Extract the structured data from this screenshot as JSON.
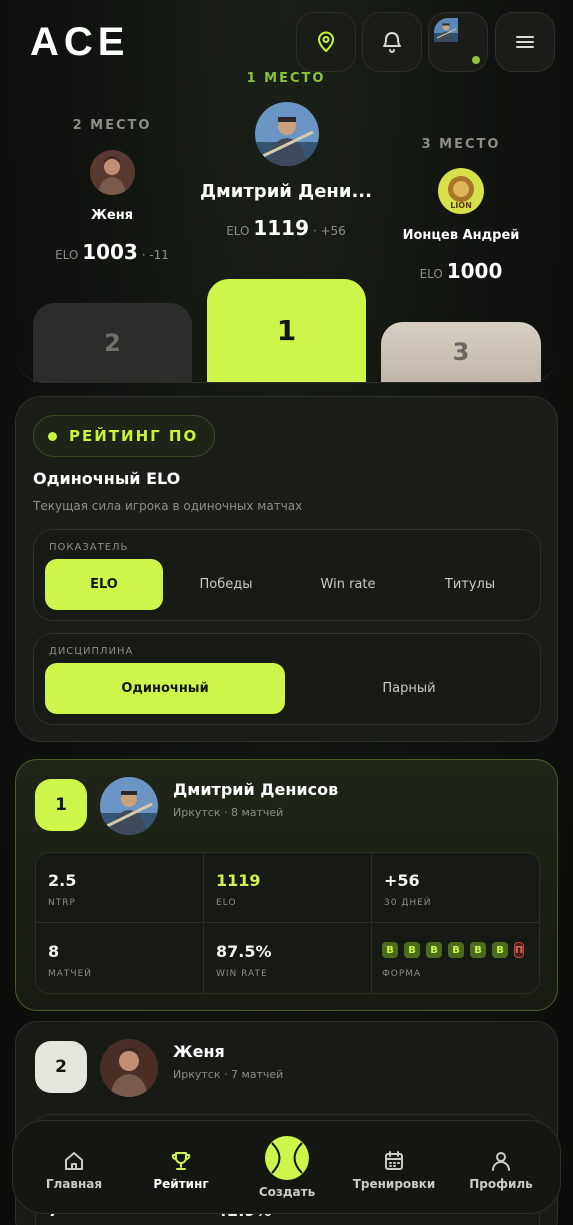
{
  "header": {
    "logo": "ACE"
  },
  "podium": {
    "first": {
      "label": "1 МЕСТО",
      "name": "Дмитрий Дени...",
      "elo_prefix": "ELO",
      "elo": "1119",
      "delta": "· +56",
      "block": "1"
    },
    "second": {
      "label": "2 МЕСТО",
      "name": "Женя",
      "elo_prefix": "ELO",
      "elo": "1003",
      "delta": "· -11",
      "block": "2"
    },
    "third": {
      "label": "3 МЕСТО",
      "name": "Ионцев Андрей",
      "elo_prefix": "ELO",
      "elo": "1000",
      "block": "3",
      "avatar_text": "LION"
    }
  },
  "rating_panel": {
    "chip": "РЕЙТИНГ ПО",
    "title": "Одиночный ELO",
    "subtitle": "Текущая сила игрока в одиночных матчах",
    "metric": {
      "label": "ПОКАЗАТЕЛЬ",
      "options": [
        "ELO",
        "Победы",
        "Win rate",
        "Титулы"
      ],
      "selected": "ELO"
    },
    "discipline": {
      "label": "ДИСЦИПЛИНА",
      "options": [
        "Одиночный",
        "Парный"
      ],
      "selected": "Одиночный"
    }
  },
  "players": [
    {
      "rank": "1",
      "name": "Дмитрий Денисов",
      "meta": "Иркутск · 8 матчей",
      "stats": [
        {
          "value": "2.5",
          "label": "NTRP"
        },
        {
          "value": "1119",
          "label": "ELO"
        },
        {
          "value": "+56",
          "label": "30 ДНЕЙ"
        },
        {
          "value": "8",
          "label": "МАТЧЕЙ"
        },
        {
          "value": "87.5%",
          "label": "WIN RATE"
        }
      ],
      "form_label": "ФОРМА",
      "form": [
        "В",
        "В",
        "В",
        "В",
        "В",
        "В",
        "П"
      ]
    },
    {
      "rank": "2",
      "name": "Женя",
      "meta": "Иркутск · 7 матчей",
      "partial_value_1": "7",
      "partial_value_2": "42.9%"
    }
  ],
  "nav": {
    "items": [
      {
        "label": "Главная",
        "icon": "home-icon"
      },
      {
        "label": "Рейтинг",
        "icon": "trophy-icon"
      },
      {
        "label": "Создать",
        "icon": "tennis-ball-icon"
      },
      {
        "label": "Тренировки",
        "icon": "calendar-icon"
      },
      {
        "label": "Профиль",
        "icon": "user-icon"
      }
    ],
    "active": "Рейтинг"
  },
  "colors": {
    "accent": "#cdf54a",
    "background": "#0f120e",
    "card": "#1a1d18",
    "loss": "#e06a58"
  }
}
